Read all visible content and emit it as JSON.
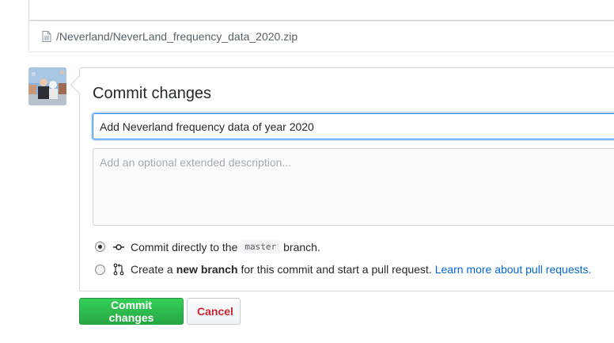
{
  "file": {
    "path": "/Neverland/NeverLand_frequency_data_2020.zip",
    "icon": "file-icon"
  },
  "commit": {
    "title": "Commit changes",
    "summary_value": "Add Neverland frequency data of year 2020",
    "description_placeholder": "Add an optional extended description...",
    "option_direct": {
      "text_before": "Commit directly to the",
      "branch": "master",
      "text_after": "branch.",
      "selected": true
    },
    "option_new_branch": {
      "text_before": "Create a",
      "bold_text": "new branch",
      "text_after": "for this commit and start a pull request.",
      "link_text": "Learn more about pull requests.",
      "selected": false
    }
  },
  "buttons": {
    "commit_label": "Commit changes",
    "cancel_label": "Cancel"
  },
  "colors": {
    "primary_green": "#28a745",
    "cancel_red": "#cb2431",
    "link_blue": "#0366d6",
    "focus_blue": "#2188ff"
  }
}
